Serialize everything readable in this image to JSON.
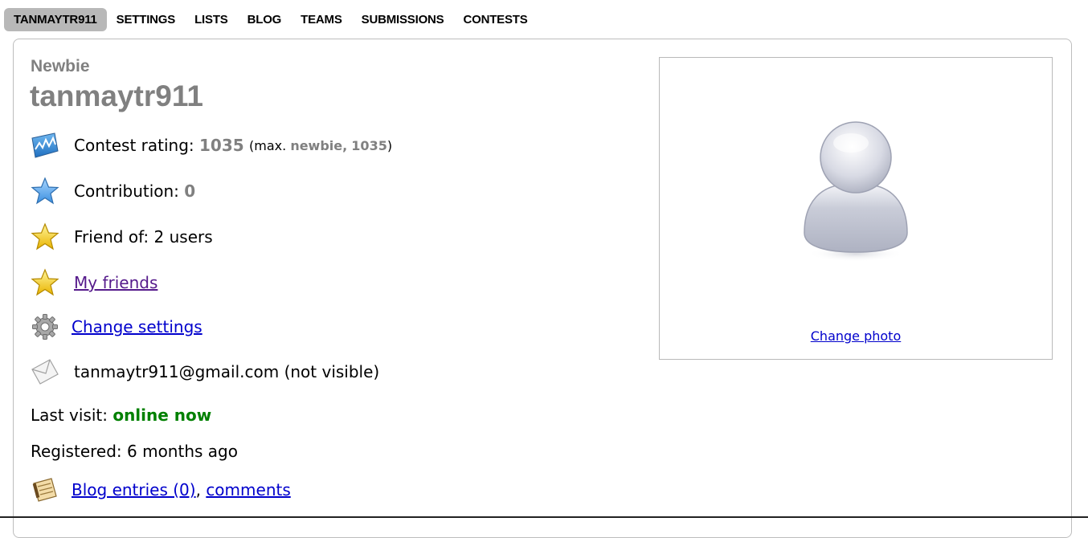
{
  "nav": {
    "tabs": [
      {
        "label": "TANMAYTR911",
        "active": true
      },
      {
        "label": "SETTINGS"
      },
      {
        "label": "LISTS"
      },
      {
        "label": "BLOG"
      },
      {
        "label": "TEAMS"
      },
      {
        "label": "SUBMISSIONS"
      },
      {
        "label": "CONTESTS"
      }
    ]
  },
  "profile": {
    "rank": "Newbie",
    "handle": "tanmaytr911",
    "contest_rating_label": "Contest rating:",
    "contest_rating_value": "1035",
    "max_open": "(max.",
    "max_rank": "newbie,",
    "max_value": "1035",
    "max_close": ")",
    "contribution_label": "Contribution:",
    "contribution_value": "0",
    "friend_of": "Friend of: 2 users",
    "my_friends": "My friends",
    "change_settings": "Change settings",
    "email": "tanmaytr911@gmail.com (not visible)",
    "last_visit_label": "Last visit:",
    "last_visit_value": "online now",
    "registered": "Registered: 6 months ago",
    "blog_entries": "Blog entries (0)",
    "comma": ",",
    "comments": "comments"
  },
  "photo": {
    "change_photo": "Change photo"
  },
  "icons": {
    "rating": "rating-chart-icon",
    "contribution": "blue-star-icon",
    "friend_of": "gold-star-icon",
    "my_friends": "gold-star-icon",
    "settings": "gear-icon",
    "email": "envelope-icon",
    "blog": "blog-notepad-icon"
  },
  "colors": {
    "rank_gray": "#808080",
    "online_green": "#008000",
    "link_blue": "#0000cc",
    "visited_purple": "#551a8b",
    "active_tab": "#b8b8b8"
  }
}
